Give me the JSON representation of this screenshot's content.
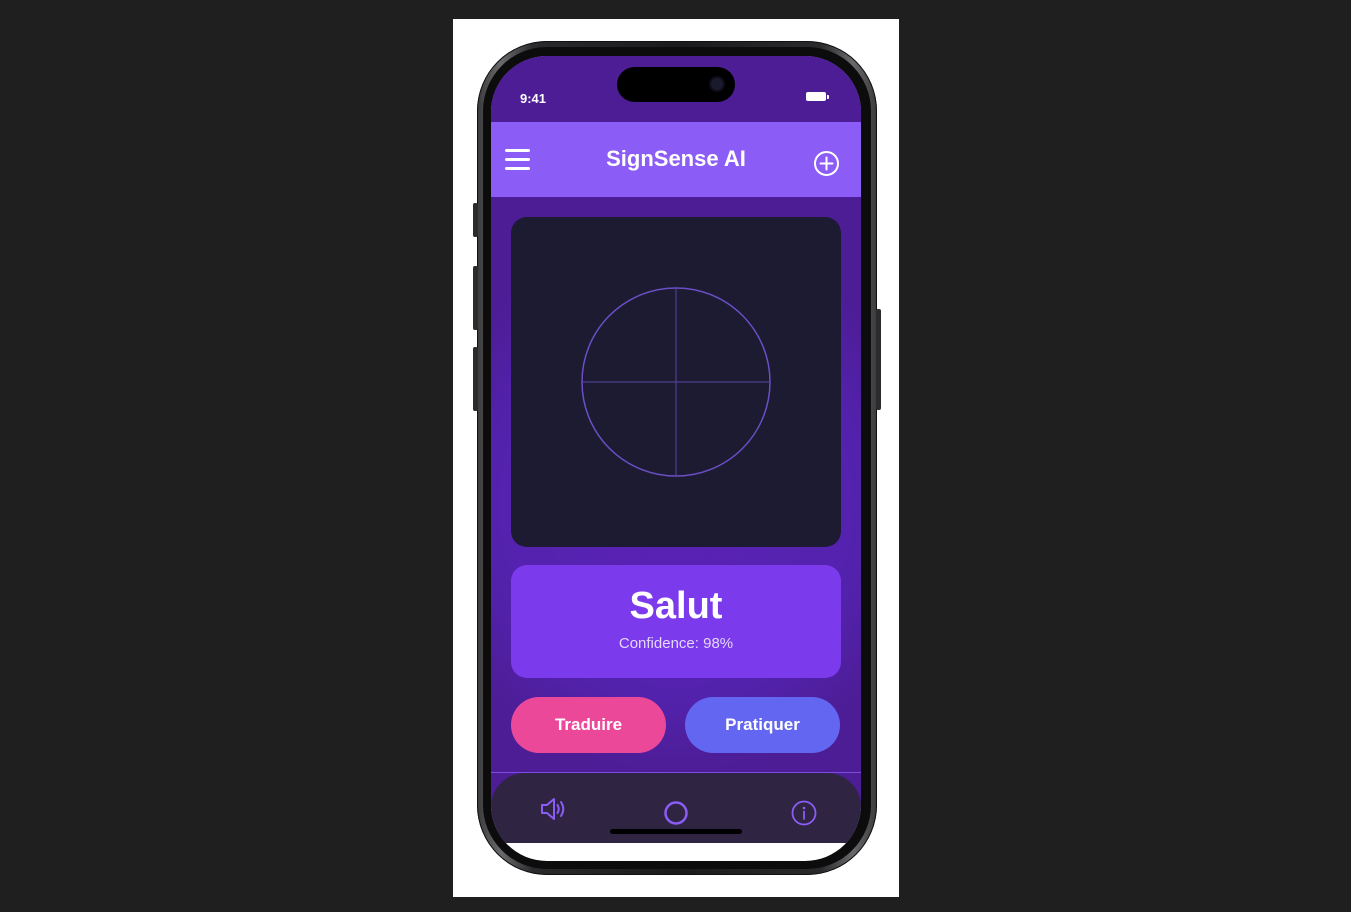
{
  "status_bar": {
    "time": "9:41"
  },
  "header": {
    "title": "SignSense AI"
  },
  "icons": {
    "menu": "hamburger-menu-icon",
    "add": "plus-circle-icon",
    "speaker": "speaker-icon",
    "record": "record-ring-icon",
    "info": "info-icon"
  },
  "result": {
    "word": "Salut",
    "confidence": "Confidence: 98%"
  },
  "actions": {
    "translate_label": "Traduire",
    "practice_label": "Pratiquer"
  },
  "colors": {
    "background": "#4c1d95",
    "header": "#8b5cf6",
    "camera_panel": "#1c1b31",
    "result_card": "#7c3aed",
    "translate_button": "#ec4899",
    "practice_button": "#6366f1",
    "tab_bar": "#2f2543",
    "tab_icon": "#8b5cf6"
  }
}
